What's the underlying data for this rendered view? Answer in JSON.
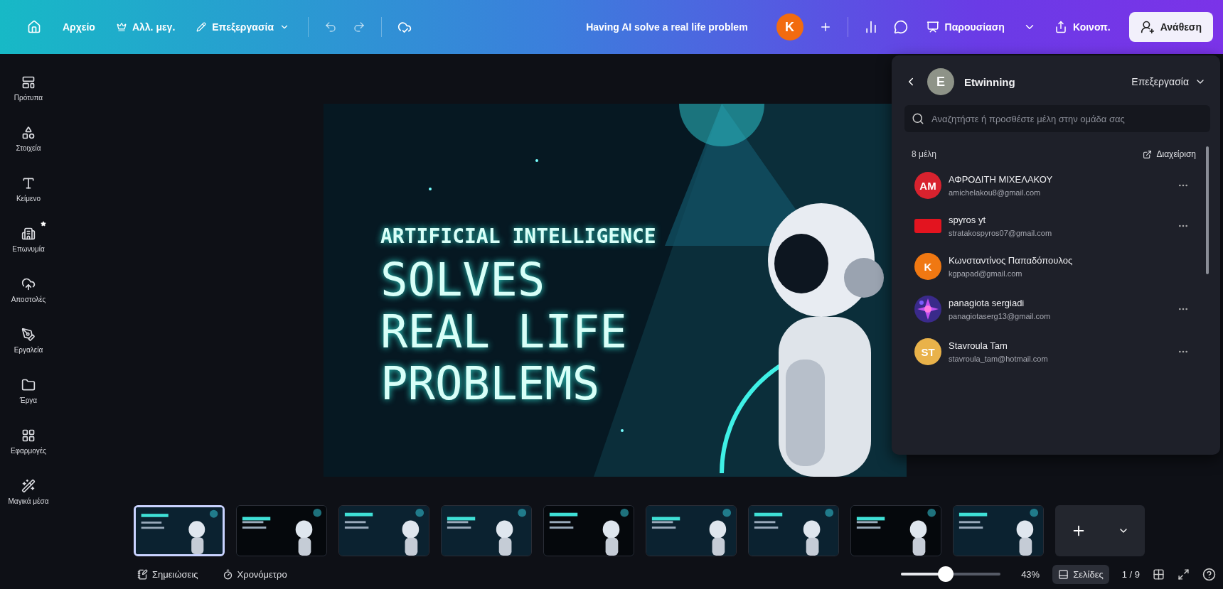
{
  "topbar": {
    "menus": [
      {
        "kind": "home"
      },
      {
        "kind": "text",
        "label": "Αρχείο"
      },
      {
        "kind": "crown",
        "label": "Αλλ. μεγ."
      },
      {
        "kind": "edit",
        "label": "Επεξεργασία"
      }
    ],
    "title": "Having AI solve a real life problem",
    "user_initial": "K",
    "present_label": "Παρουσίαση",
    "share_label": "Κοινοπ.",
    "assign_label": "Ανάθεση"
  },
  "sidebar": [
    {
      "label": "Πρότυπα",
      "kind": "template",
      "new": false
    },
    {
      "label": "Στοιχεία",
      "kind": "shapes",
      "new": false
    },
    {
      "label": "Κείμενο",
      "kind": "text",
      "new": false
    },
    {
      "label": "Επωνυμία",
      "kind": "brand",
      "new": true
    },
    {
      "label": "Αποστολές",
      "kind": "upload",
      "new": false
    },
    {
      "label": "Εργαλεία",
      "kind": "draw",
      "new": false
    },
    {
      "label": "Έργα",
      "kind": "folder",
      "new": false
    },
    {
      "label": "Εφαρμογές",
      "kind": "apps",
      "new": false
    },
    {
      "label": "Μαγικά μέσα",
      "kind": "magic",
      "new": false
    }
  ],
  "slide": {
    "kicker": "ARTIFICIAL INTELLIGENCE",
    "lines": [
      "SOLVES",
      "REAL LIFE",
      "PROBLEMS"
    ]
  },
  "team_panel": {
    "team_initial": "E",
    "team_name": "Etwinning",
    "role": "Επεξεργασία",
    "search": {
      "placeholder": "Αναζητήστε ή προσθέστε μέλη στην ομάδα σας"
    },
    "count": "8 μέλη",
    "manage": "Διαχείριση",
    "members": [
      {
        "name": "ΑΦΡΟΔΙΤΗ ΜΙΧΕΛΑΚΟΥ",
        "email": "amichelakou8@gmail.com",
        "avatar": {
          "kind": "initials",
          "text": "AM",
          "color": "#d8222e"
        },
        "menu": true
      },
      {
        "name": "spyros yt",
        "email": "stratakospyros07@gmail.com",
        "avatar": {
          "kind": "banner",
          "color": "#e3141f"
        },
        "menu": true
      },
      {
        "name": "Κωνσταντίνος Παπαδόπουλος",
        "email": "kgpapad@gmail.com",
        "avatar": {
          "kind": "initials",
          "text": "K",
          "color": "#f07812"
        },
        "menu": false
      },
      {
        "name": "panagiota sergiadi",
        "email": "panagiotaserg13@gmail.com",
        "menu": true
      },
      {
        "name": "Stavroula Tam",
        "email": "stavroula_tam@hotmail.com",
        "avatar": {
          "kind": "initials",
          "text": "ST",
          "color": "#e9b24a"
        },
        "menu": true
      }
    ]
  },
  "pages": [
    {
      "selected": true
    },
    {
      "selected": false
    },
    {
      "selected": false
    },
    {
      "selected": false
    },
    {
      "selected": false
    },
    {
      "selected": false
    },
    {
      "selected": false
    },
    {
      "selected": false
    },
    {
      "selected": false
    }
  ],
  "bottombar": {
    "notes": "Σημειώσεις",
    "timer": "Χρονόμετρο",
    "zoom": {
      "level": 0.45
    },
    "zoom_reading": "43%",
    "pages_label": "Σελίδες",
    "page_count": "1 / 9"
  }
}
